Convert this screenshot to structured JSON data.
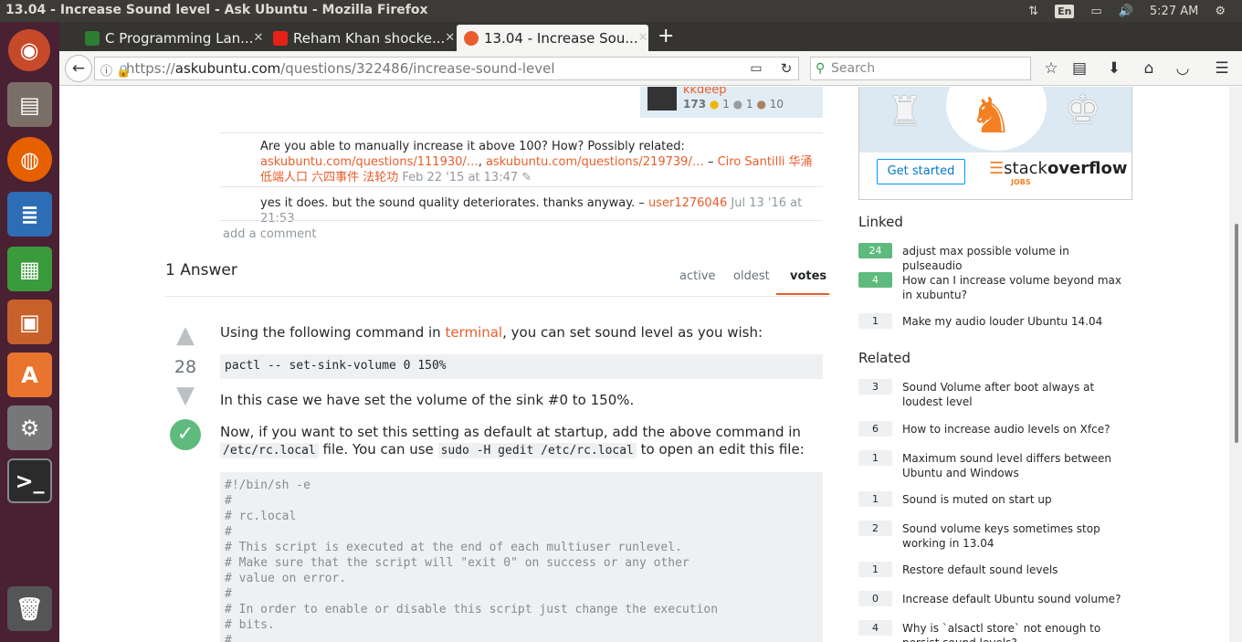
{
  "system": {
    "window_title": "13.04 - Increase Sound level - Ask Ubuntu - Mozilla Firefox",
    "keyboard": "En",
    "time": "5:27 AM"
  },
  "tabs": [
    {
      "label": "C Programming Lan...",
      "fav": "#2e7d32"
    },
    {
      "label": "Reham Khan shocke...",
      "fav": "#e62117"
    },
    {
      "label": "13.04 - Increase Sou...",
      "fav": "#e85d2b"
    }
  ],
  "nav": {
    "url_prefix": "https://",
    "url_host": "askubuntu.com",
    "url_path": "/questions/322486/increase-sound-level",
    "search_placeholder": "Search"
  },
  "user": {
    "name": "kkdeep",
    "rep": "173",
    "gold": "1",
    "silver": "1",
    "bronze": "10"
  },
  "comments": [
    {
      "text": "Are you able to manually increase it above 100? How? Possibly related: ",
      "link1": "askubuntu.com/questions/111930/…",
      "sep": ", ",
      "link2": "askubuntu.com/questions/219739/…",
      "dash": " – ",
      "author": "Ciro Santilli 华涌低端人口 六四事件 法轮功",
      "date": " Feb 22 '15 at 13:47"
    },
    {
      "text": "yes it does. but the sound quality deteriorates. thanks anyway. – ",
      "author": "user1276046",
      "date": " Jul 13 '16 at 21:53"
    }
  ],
  "add_comment": "add a comment",
  "answers_header": "1 Answer",
  "sort": {
    "active": "active",
    "oldest": "oldest",
    "votes": "votes"
  },
  "answer": {
    "votes": "28",
    "p1_pre": "Using the following command in ",
    "p1_link": "terminal",
    "p1_post": ", you can set sound level as you wish:",
    "cmd1": "pactl -- set-sink-volume 0 150%",
    "p2": "In this case we have set the volume of the sink #0 to 150%.",
    "p3_a": "Now, if you want to set this setting as default at startup, add the above command in",
    "p3_code1": "/etc/rc.local",
    "p3_b": " file. You can use ",
    "p3_code2": "sudo -H gedit /etc/rc.local",
    "p3_c": " to open an edit this file:",
    "code_lines": [
      "#!/bin/sh -e",
      "#",
      "# rc.local",
      "#",
      "# This script is executed at the end of each multiuser runlevel.",
      "# Make sure that the script will \"exit 0\" on success or any other",
      "# value on error.",
      "#",
      "# In order to enable or disable this script just change the execution",
      "# bits.",
      "#"
    ]
  },
  "ad": {
    "button": "Get started",
    "brand_pre": "stack",
    "brand_post": "overflow",
    "jobs": "JOBS"
  },
  "linked": {
    "title": "Linked",
    "items": [
      {
        "score": "24",
        "label": "adjust max possible volume in pulseaudio",
        "accepted": true
      },
      {
        "score": "4",
        "label": "How can I increase volume beyond max in xubuntu?",
        "accepted": true
      },
      {
        "score": "1",
        "label": "Make my audio louder Ubuntu 14.04",
        "accepted": false
      }
    ]
  },
  "related": {
    "title": "Related",
    "items": [
      {
        "score": "3",
        "label": "Sound Volume after boot always at loudest level"
      },
      {
        "score": "6",
        "label": "How to increase audio levels on Xfce?"
      },
      {
        "score": "1",
        "label": "Maximum sound level differs between Ubuntu and Windows"
      },
      {
        "score": "1",
        "label": "Sound is muted on start up"
      },
      {
        "score": "2",
        "label": "Sound volume keys sometimes stop working in 13.04"
      },
      {
        "score": "1",
        "label": "Restore default sound levels"
      },
      {
        "score": "0",
        "label": "Increase default Ubuntu sound volume?"
      },
      {
        "score": "4",
        "label": "Why is `alsactl store` not enough to persist sound levels?"
      }
    ]
  },
  "colors": {
    "accent": "#e85d2b",
    "accepted": "#5fba7d",
    "launcher": "#4a2033"
  }
}
